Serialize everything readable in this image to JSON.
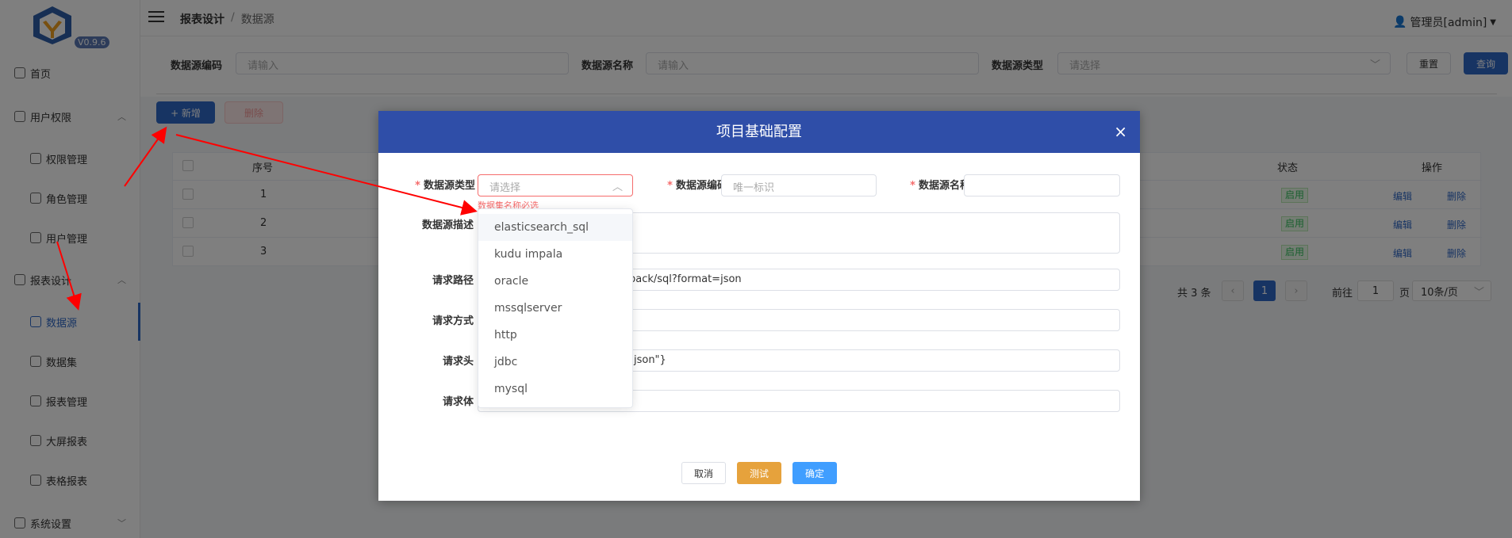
{
  "sidebar": {
    "version": "V0.9.6",
    "items": [
      {
        "label": "首页",
        "icon": "home-icon"
      },
      {
        "label": "用户权限",
        "icon": "user-group-icon"
      },
      {
        "label": "权限管理",
        "icon": "shield-icon"
      },
      {
        "label": "角色管理",
        "icon": "role-icon"
      },
      {
        "label": "用户管理",
        "icon": "user-icon"
      },
      {
        "label": "报表设计",
        "icon": "report-icon"
      },
      {
        "label": "数据源",
        "icon": "database-icon"
      },
      {
        "label": "数据集",
        "icon": "dataset-icon"
      },
      {
        "label": "报表管理",
        "icon": "report-manage-icon"
      },
      {
        "label": "大屏报表",
        "icon": "screen-icon"
      },
      {
        "label": "表格报表",
        "icon": "table-icon"
      },
      {
        "label": "系统设置",
        "icon": "settings-icon"
      }
    ]
  },
  "topbar": {
    "crumb_1": "报表设计",
    "crumb_sep": "/",
    "crumb_2": "数据源",
    "user": "管理员[admin]"
  },
  "search": {
    "code_label": "数据源编码",
    "code_placeholder": "请输入",
    "name_label": "数据源名称",
    "name_placeholder": "请输入",
    "type_label": "数据源类型",
    "type_placeholder": "请选择",
    "reset": "重置",
    "query": "查询"
  },
  "toolbar": {
    "add": "+ 新增",
    "delete": "删除"
  },
  "table": {
    "headers": {
      "index": "序号",
      "status": "状态",
      "actions": "操作"
    },
    "rows": [
      {
        "index": "1",
        "status": "启用",
        "edit": "编辑",
        "delete": "删除"
      },
      {
        "index": "2",
        "status": "启用",
        "edit": "编辑",
        "delete": "删除"
      },
      {
        "index": "3",
        "status": "启用",
        "edit": "编辑",
        "delete": "删除"
      }
    ]
  },
  "pager": {
    "total": "共 3 条",
    "current": "1",
    "goto": "前往",
    "goto_value": "1",
    "page": "页",
    "size": "10条/页"
  },
  "modal": {
    "title": "项目基础配置",
    "close": "×",
    "type_label": "数据源类型",
    "type_placeholder": "请选择",
    "type_error": "数据集名称必选",
    "code_label": "数据源编码",
    "code_placeholder": "唯一标识",
    "name_label": "数据源名称",
    "desc_label": "数据源描述",
    "path_label": "请求路径",
    "path_value": "pack/sql?format=json",
    "method_label": "请求方式",
    "header_label": "请求头",
    "header_value": "\"json\"}",
    "body_label": "请求体",
    "cancel": "取消",
    "test": "测试",
    "confirm": "确定"
  },
  "dropdown": {
    "options": [
      "elasticsearch_sql",
      "kudu impala",
      "oracle",
      "mssqlserver",
      "http",
      "jdbc",
      "mysql"
    ]
  },
  "colors": {
    "primary": "#2f68c7",
    "modal_header": "#2f4ea8",
    "danger": "#f56c6c",
    "test_button": "#e6a23c",
    "confirm_button": "#409eff",
    "annotation_arrow": "#ff0000"
  }
}
